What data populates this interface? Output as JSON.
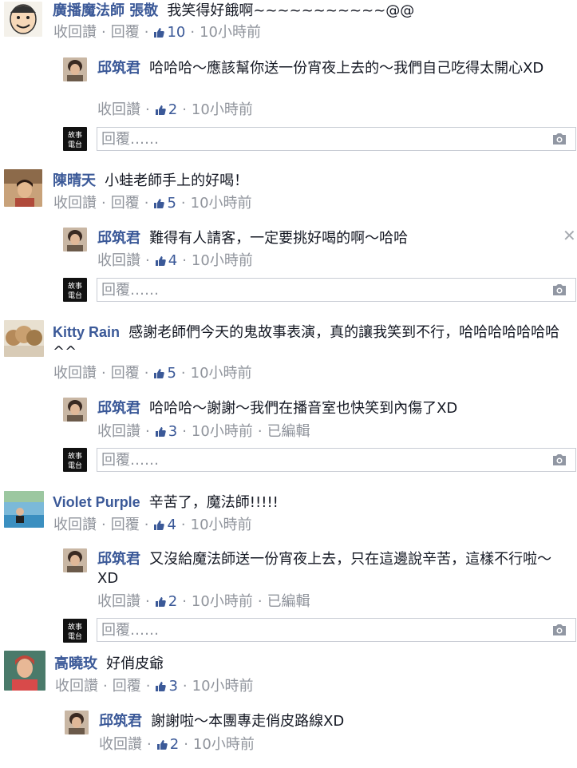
{
  "comments": [
    {
      "author": "廣播魔法師 張敬",
      "text": "我笑得好餓啊~~~~~~~~~~~@@",
      "actions": {
        "retract": "收回讚",
        "reply": "回覆",
        "likes": "10",
        "time": "10小時前"
      },
      "reply": {
        "author": "邱筑君",
        "text": "哈哈哈～應該幫你送一份宵夜上去的～我們自己吃得太開心XD",
        "actions": {
          "retract": "收回讚",
          "likes": "2",
          "time": "10小時前"
        }
      },
      "reply_placeholder": "回覆……"
    },
    {
      "author": "陳晴天",
      "text": "小蛙老師手上的好喝！",
      "actions": {
        "retract": "收回讚",
        "reply": "回覆",
        "likes": "5",
        "time": "10小時前"
      },
      "reply": {
        "author": "邱筑君",
        "text": "難得有人請客，一定要挑好喝的啊～哈哈",
        "actions": {
          "retract": "收回讚",
          "likes": "4",
          "time": "10小時前"
        }
      },
      "reply_placeholder": "回覆……"
    },
    {
      "author": "Kitty Rain",
      "text": "感謝老師們今天的鬼故事表演，真的讓我笑到不行，哈哈哈哈哈哈哈^^",
      "actions": {
        "retract": "收回讚",
        "reply": "回覆",
        "likes": "5",
        "time": "10小時前"
      },
      "reply": {
        "author": "邱筑君",
        "text": "哈哈哈～謝謝～我們在播音室也快笑到內傷了XD",
        "actions": {
          "retract": "收回讚",
          "likes": "3",
          "time": "10小時前",
          "edited": "已編輯"
        }
      },
      "reply_placeholder": "回覆……"
    },
    {
      "author": "Violet Purple",
      "text": "辛苦了，魔法師!!!!!",
      "actions": {
        "retract": "收回讚",
        "reply": "回覆",
        "likes": "4",
        "time": "10小時前"
      },
      "reply": {
        "author": "邱筑君",
        "text": "又沒給魔法師送一份宵夜上去，只在這邊說辛苦，這樣不行啦～XD",
        "actions": {
          "retract": "收回讚",
          "likes": "2",
          "time": "10小時前",
          "edited": "已編輯"
        }
      },
      "reply_placeholder": "回覆……"
    },
    {
      "author": "高曉玫",
      "text": "好俏皮爺",
      "actions": {
        "retract": "收回讚",
        "reply": "回覆",
        "likes": "3",
        "time": "10小時前"
      },
      "reply": {
        "author": "邱筑君",
        "text": "謝謝啦～本團專走俏皮路線XD",
        "actions": {
          "retract": "收回讚",
          "likes": "2",
          "time": "10小時前"
        }
      }
    }
  ],
  "page_avatar_text": [
    "故事",
    "電台"
  ],
  "colors": {
    "author": "#3b5998",
    "meta": "#90949c",
    "text": "#141823",
    "border": "#c8ccd4"
  },
  "icons": {
    "like": "thumbs-up-icon",
    "camera": "camera-icon",
    "close": "close-icon"
  }
}
